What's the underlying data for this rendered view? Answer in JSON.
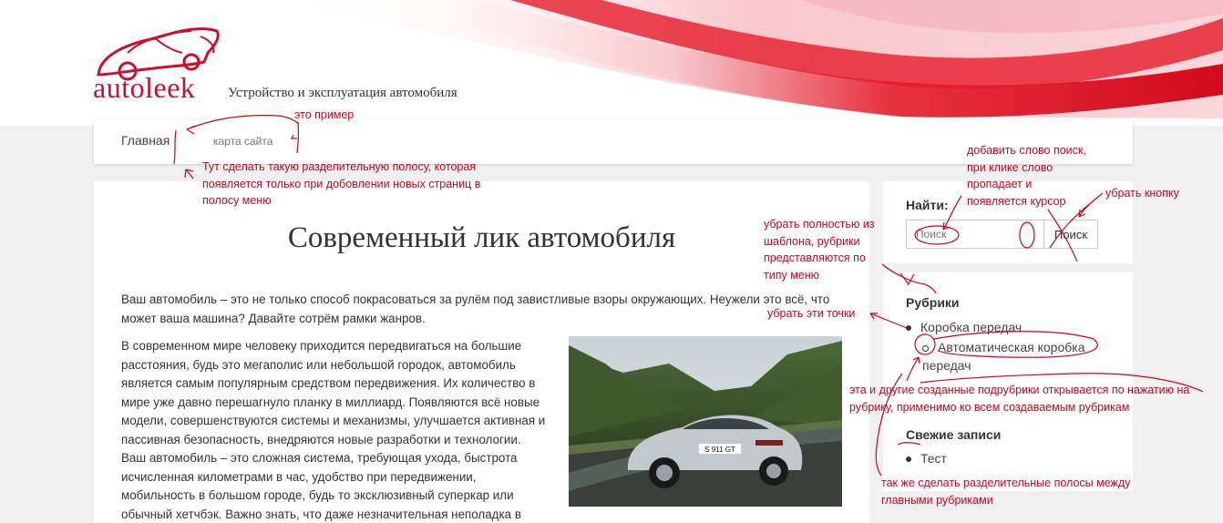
{
  "header": {
    "logo_text": "autoleek",
    "tagline": "Устройство и эксплуатация автомобиля",
    "accent_color": "#c8102e"
  },
  "nav": {
    "items": [
      {
        "label": "Главная"
      },
      {
        "label": "карта сайта"
      }
    ]
  },
  "article": {
    "title": "Современный лик автомобиля",
    "paragraphs": [
      "Ваш автомобиль – это не только способ покрасоваться за рулём под завистливые взоры окружающих. Неужели это всё, что может ваша машина? Давайте сотрём рамки жанров.",
      "В современном мире человеку приходится передвигаться на большие расстояния, будь это мегаполис или небольшой городок, автомобиль является самым популярным средством передвижения. Их количество в мире уже давно перешагнуло планку в миллиард. Появляются всё новые модели, совершенствуются системы и механизмы, улучшается активная и пассивная безопасность, внедряются новые разработки и технологии.",
      "Ваш автомобиль – это сложная система, требующая ухода, быстрота исчисленная километрами в час, удобство при передвижении, мобильность в большом городе, будь то эксклюзивный суперкар или обычный хетчбэк. Важно знать, что даже незначительная неполадка в"
    ],
    "photo_plate": "S 911 GT"
  },
  "sidebar": {
    "search": {
      "title": "Найти:",
      "placeholder": "Поиск",
      "button_label": "Поиск"
    },
    "rubrics": {
      "title": "Рубрики",
      "items": [
        {
          "label": "Коробка передач",
          "children": [
            {
              "label": "Автоматическая коробка передач"
            }
          ]
        }
      ]
    },
    "recent": {
      "title": "Свежие записи",
      "items": [
        {
          "label": "Тест"
        }
      ]
    }
  },
  "annotations": {
    "example": "это пример",
    "separator": "Тут сделать такую разделительную полосу, которая появляется только при добовлении новых страниц в полосу меню",
    "add_word": "добавить слово поиск, при клике слово пропадает и появляется курсор",
    "remove_button": "убрать кнопку",
    "remove_rubrics": "убрать полностью из шаблона, рубрики представляются по типу меню",
    "remove_dots": "убрать эти точки",
    "subrubrics": "эта и другие созданные подрубрики открывается по нажатию на рубрику, применимо ко всем создаваемым рубрикам",
    "main_separators": "так же сделать разделительные полосы между главными рубриками"
  }
}
